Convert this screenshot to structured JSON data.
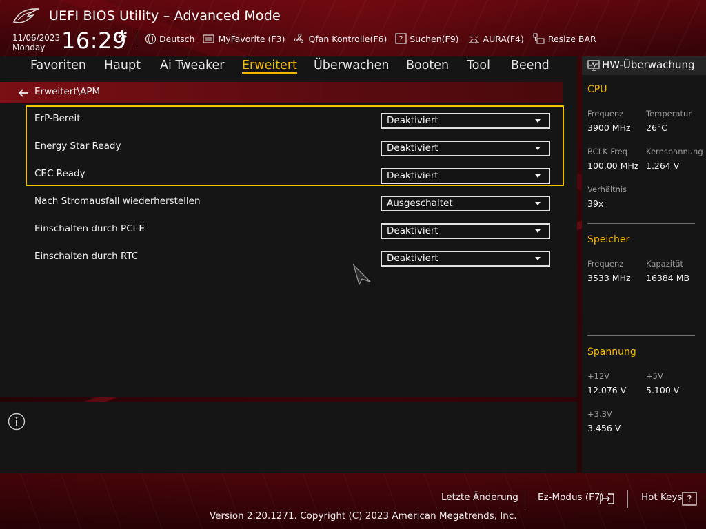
{
  "header": {
    "title": "UEFI BIOS Utility – Advanced Mode",
    "date": "11/06/2023",
    "weekday": "Monday",
    "time": "16:29",
    "toolbar": {
      "language": "Deutsch",
      "myfavorite": "MyFavorite (F3)",
      "qfan": "Qfan Kontrolle(F6)",
      "search": "Suchen(F9)",
      "aura": "AURA(F4)",
      "resize_bar": "Resize BAR"
    }
  },
  "nav": {
    "tabs": [
      "Favoriten",
      "Haupt",
      "Ai Tweaker",
      "Erweitert",
      "Überwachen",
      "Booten",
      "Tool",
      "Beend"
    ],
    "active": "Erweitert"
  },
  "breadcrumb": "Erweitert\\APM",
  "settings": [
    {
      "label": "ErP-Bereit",
      "value": "Deaktiviert"
    },
    {
      "label": "Energy Star Ready",
      "value": "Deaktiviert"
    },
    {
      "label": "CEC Ready",
      "value": "Deaktiviert"
    },
    {
      "label": "Nach Stromausfall wiederherstellen",
      "value": "Ausgeschaltet"
    },
    {
      "label": "Einschalten durch PCI-E",
      "value": "Deaktiviert"
    },
    {
      "label": "Einschalten durch RTC",
      "value": "Deaktiviert"
    }
  ],
  "hw_monitor": {
    "title": "HW-Überwachung",
    "cpu": {
      "heading": "CPU",
      "freq_label": "Frequenz",
      "freq_value": "3900 MHz",
      "temp_label": "Temperatur",
      "temp_value": "26°C",
      "bclk_label": "BCLK Freq",
      "bclk_value": "100.00 MHz",
      "vcore_label": "Kernspannung",
      "vcore_value": "1.264 V",
      "ratio_label": "Verhältnis",
      "ratio_value": "39x"
    },
    "memory": {
      "heading": "Speicher",
      "freq_label": "Frequenz",
      "freq_value": "3533 MHz",
      "cap_label": "Kapazität",
      "cap_value": "16384 MB"
    },
    "voltage": {
      "heading": "Spannung",
      "v12_label": "+12V",
      "v12_value": "12.076 V",
      "v5_label": "+5V",
      "v5_value": "5.100 V",
      "v33_label": "+3.3V",
      "v33_value": "3.456 V"
    }
  },
  "footer": {
    "last_change": "Letzte Änderung",
    "ez_mode": "Ez-Modus (F7)",
    "hot_keys": "Hot Keys",
    "version": "Version 2.20.1271. Copyright (C) 2023 American Megatrends, Inc."
  },
  "colors": {
    "accent": "#f5b800",
    "highlight_border": "#f5c400",
    "breadcrumb_bg": "#7a0f14",
    "panel_bg": "#151515"
  }
}
